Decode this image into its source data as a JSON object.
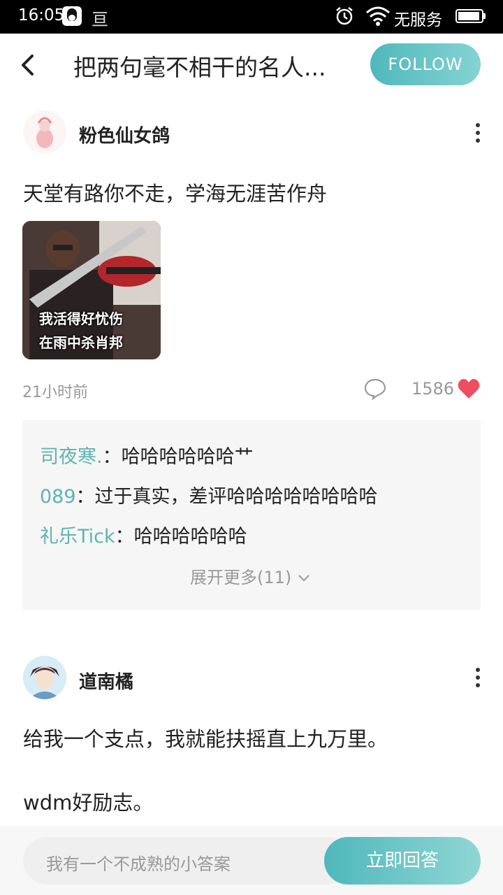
{
  "status": {
    "time": "16:05",
    "app_glyph": "亘",
    "service": "无服务"
  },
  "header": {
    "title": "把两句毫不相干的名人...",
    "follow_label": "FOLLOW"
  },
  "post1": {
    "author": "粉色仙女鸽",
    "text": "天堂有路你不走，学海无涯苦作舟",
    "image_caption_line1": "我活得好忧伤",
    "image_caption_line2": "在雨中杀肖邦",
    "time": "21小时前",
    "likes": "1586",
    "comments": [
      {
        "name": "司夜寒.",
        "sep": "：",
        "text": "哈哈哈哈哈哈艹"
      },
      {
        "name": "089",
        "sep": "：",
        "text": "过于真实，差评哈哈哈哈哈哈哈哈"
      },
      {
        "name": "礼乐Tick",
        "sep": "：",
        "text": "哈哈哈哈哈哈"
      }
    ],
    "expand_label": "展开更多(11)"
  },
  "post2": {
    "author": "道南橘",
    "text_line1": "给我一个支点，我就能扶摇直上九万里。",
    "text_line2": "wdm好励志。"
  },
  "bottom": {
    "placeholder": "我有一个不成熟的小答案",
    "answer_label": "立即回答"
  },
  "colors": {
    "accent": "#5fb3b3",
    "heart": "#f04d5f"
  }
}
